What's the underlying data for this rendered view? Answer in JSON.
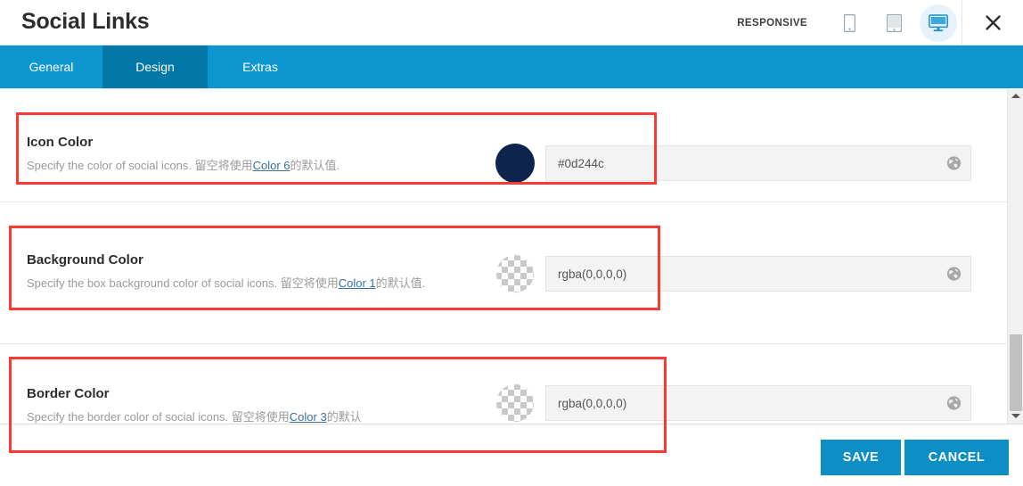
{
  "header": {
    "title": "Social Links",
    "responsive_label": "RESPONSIVE",
    "devices": [
      {
        "name": "mobile-view-button",
        "icon": "mobile-icon",
        "active": false
      },
      {
        "name": "tablet-view-button",
        "icon": "tablet-icon",
        "active": false
      },
      {
        "name": "desktop-view-button",
        "icon": "desktop-icon",
        "active": true
      }
    ],
    "close_label": "✕"
  },
  "tabs": [
    {
      "label": "General",
      "active": false
    },
    {
      "label": "Design",
      "active": true
    },
    {
      "label": "Extras",
      "active": false
    }
  ],
  "rows": [
    {
      "title": "Icon Color",
      "desc_before": "Specify the color of social icons. 留空将使用",
      "desc_link": "Color 6",
      "desc_after": "的默认值.",
      "swatch_type": "solid",
      "swatch_color": "#0d244c",
      "value": "#0d244c"
    },
    {
      "title": "Background Color",
      "desc_before": "Specify the box background color of social icons. 留空将使用",
      "desc_link": "Color 1",
      "desc_after": "的默认值.",
      "swatch_type": "transparent",
      "swatch_color": "rgba(0,0,0,0)",
      "value": "rgba(0,0,0,0)"
    },
    {
      "title": "Border Color",
      "desc_before": "Specify the border color of social icons. 留空将使用",
      "desc_link": "Color 3",
      "desc_after": "的默认",
      "swatch_type": "transparent",
      "swatch_color": "rgba(0,0,0,0)",
      "value": "rgba(0,0,0,0)"
    }
  ],
  "footer": {
    "save_label": "SAVE",
    "cancel_label": "CANCEL"
  },
  "colors": {
    "tab_bar": "#0d97ce",
    "tab_active": "#0277a8",
    "button": "#0d8ec4",
    "annotation": "#f93a34",
    "icon_color_value": "#0d244c",
    "link": "#3b6f9e"
  }
}
